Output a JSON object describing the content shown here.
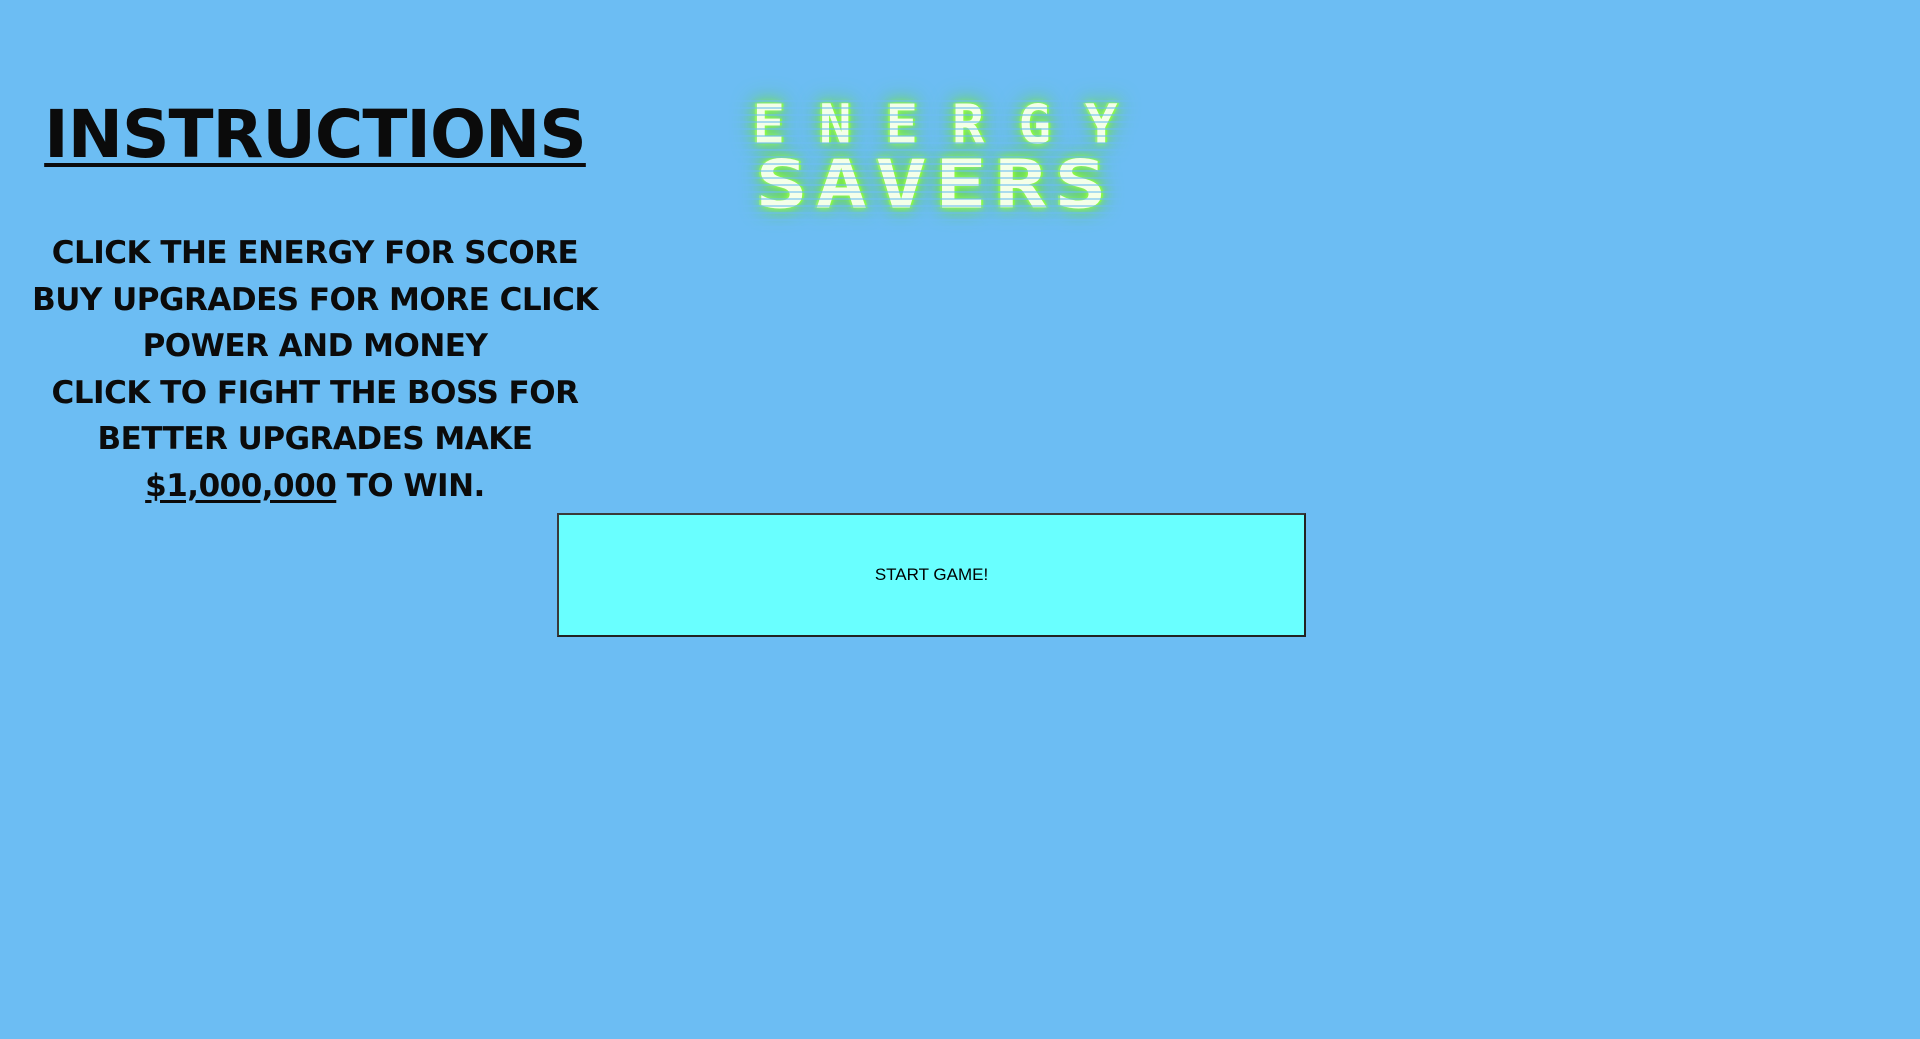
{
  "instructions": {
    "title": "INSTRUCTIONS",
    "lines": [
      "CLICK THE ENERGY FOR SCORE",
      "BUY UPGRADES FOR MORE CLICK",
      "POWER AND MONEY",
      "CLICK TO FIGHT THE BOSS FOR",
      "BETTER UPGRADES MAKE"
    ],
    "prize": "$1,000,000",
    "win_suffix": " TO WIN."
  },
  "logo": {
    "line1": "ENERGY",
    "line2": "SAVERS",
    "glow_color": "#7cf23a"
  },
  "start_button": {
    "label": "START GAME!",
    "background": "#69ffff"
  },
  "page": {
    "background": "#6cbdf3"
  }
}
